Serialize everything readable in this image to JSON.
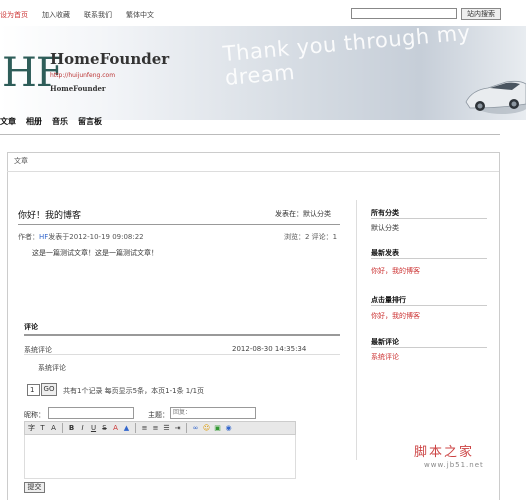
{
  "topbar": {
    "links": [
      "设为首页",
      "加入收藏",
      "联系我们",
      "繁体中文"
    ],
    "search_button": "站内搜索"
  },
  "header": {
    "logo": "HF",
    "title": "HomeFounder",
    "url": "http://huijunfeng.com",
    "subtitle": "HomeFounder",
    "slogan": "Thank you through my dream"
  },
  "nav": [
    "文章",
    "相册",
    "音乐",
    "留言板"
  ],
  "breadcrumb": "文章",
  "post": {
    "title": "你好！我的博客",
    "category": "发表在：默认分类",
    "author_label": "作者：",
    "author": "HF",
    "date": "发表于2012-10-19 09:08:22",
    "stats": "浏览：2  评论：1",
    "body": "这是一篇测试文章！这是一篇测试文章！"
  },
  "comments": {
    "heading": "评论",
    "author": "系统评论",
    "time": "2012-08-30 14:35:34",
    "text": "系统评论",
    "pager_value": "1",
    "pager_go": "GO",
    "pager_info": "共有1个记录  每页显示5条，本页1-1条  1/1页",
    "name_label": "昵称：",
    "subject_label": "主题：",
    "subject_value": "回复：",
    "submit": "提交"
  },
  "sidebar": {
    "categories_heading": "所有分类",
    "categories": [
      "默认分类"
    ],
    "latest_heading": "最新发表",
    "latest": [
      "你好，我的博客"
    ],
    "hot_heading": "点击量排行",
    "hot": [
      "你好，我的博客"
    ],
    "comments_heading": "最新评论",
    "recent_comments": [
      "系统评论"
    ]
  },
  "watermark": {
    "brand": "脚本之家",
    "site": "www.jb51.net"
  },
  "colors": {
    "accent": "#cc3333",
    "link_blue": "#3366cc",
    "logo_green": "#2e5d59"
  }
}
